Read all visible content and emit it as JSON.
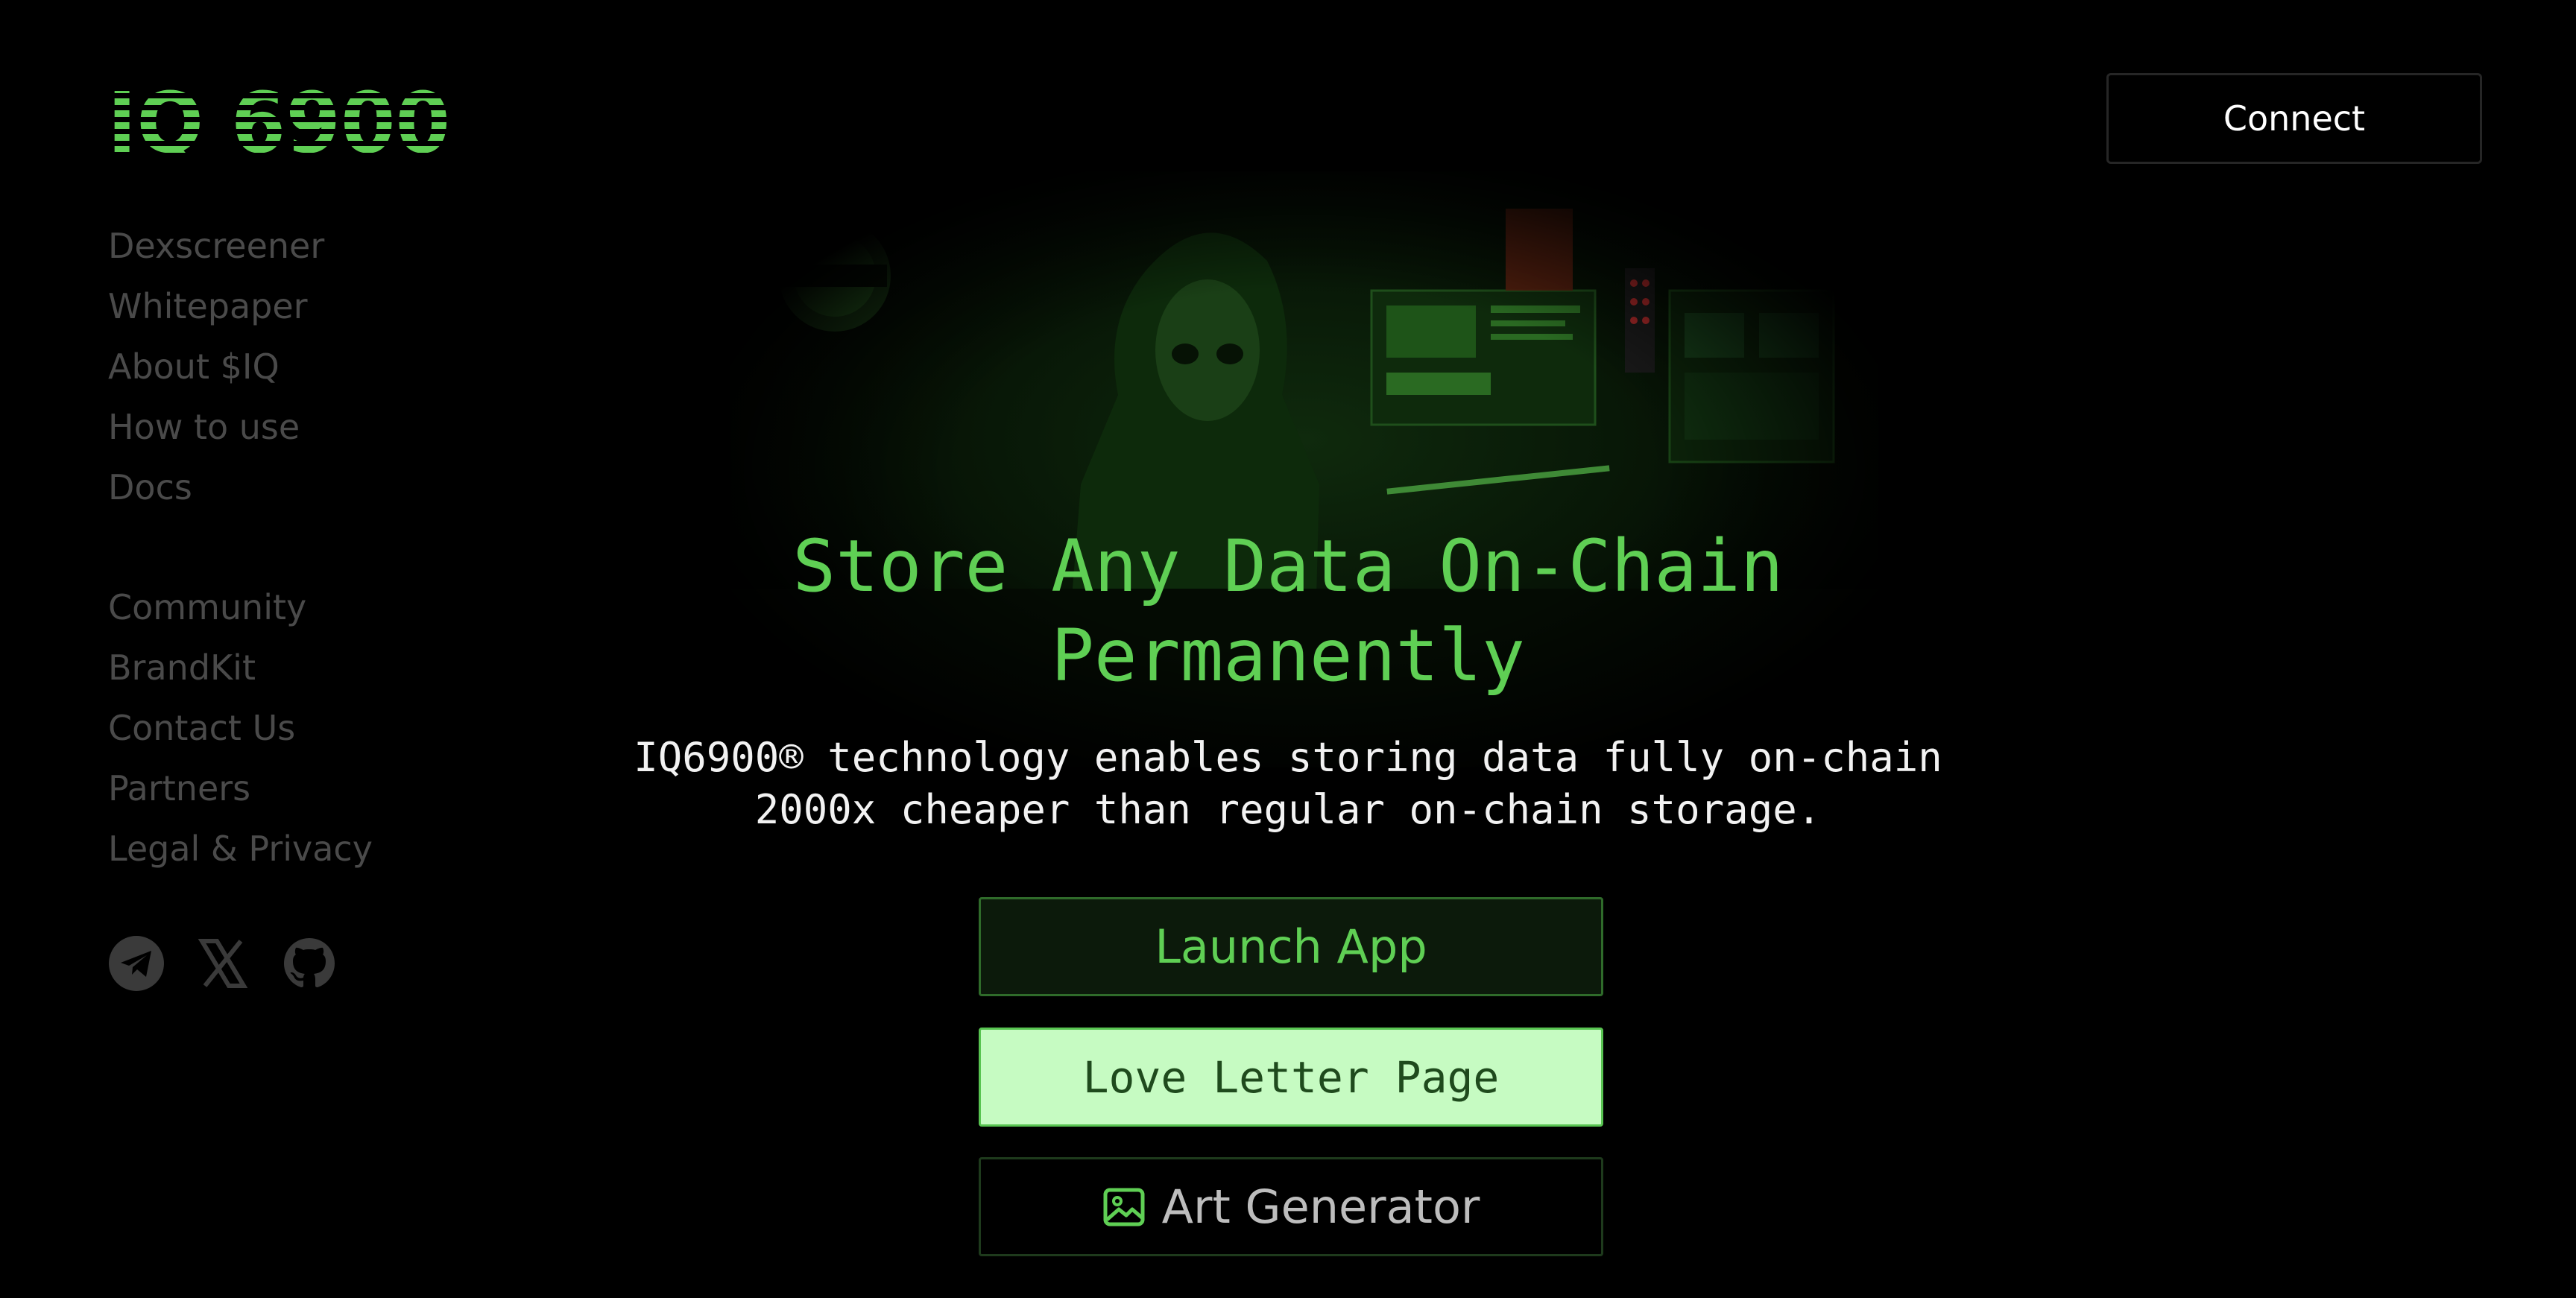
{
  "brand": {
    "logo_text": "IQ 6900",
    "accent_color": "#5fcf54"
  },
  "nav": {
    "primary": [
      {
        "label": "Dexscreener"
      },
      {
        "label": "Whitepaper"
      },
      {
        "label": "About $IQ"
      },
      {
        "label": "How to use"
      },
      {
        "label": "Docs"
      }
    ],
    "secondary": [
      {
        "label": "Community"
      },
      {
        "label": "BrandKit"
      },
      {
        "label": "Contact Us"
      },
      {
        "label": "Partners"
      },
      {
        "label": "Legal & Privacy"
      }
    ],
    "socials": [
      {
        "icon": "telegram-icon"
      },
      {
        "icon": "x-icon"
      },
      {
        "icon": "github-icon"
      }
    ]
  },
  "header": {
    "connect_label": "Connect"
  },
  "hero": {
    "title_line1": "Store Any Data On-Chain",
    "title_line2": "Permanently",
    "subtitle_line1": "IQ6900® technology enables storing data fully on-chain",
    "subtitle_line2": "2000x cheaper than regular on-chain storage.",
    "launch_label": "Launch App",
    "love_label": "Love Letter Page",
    "art_label": "Art Generator",
    "art_icon": "image-icon"
  }
}
